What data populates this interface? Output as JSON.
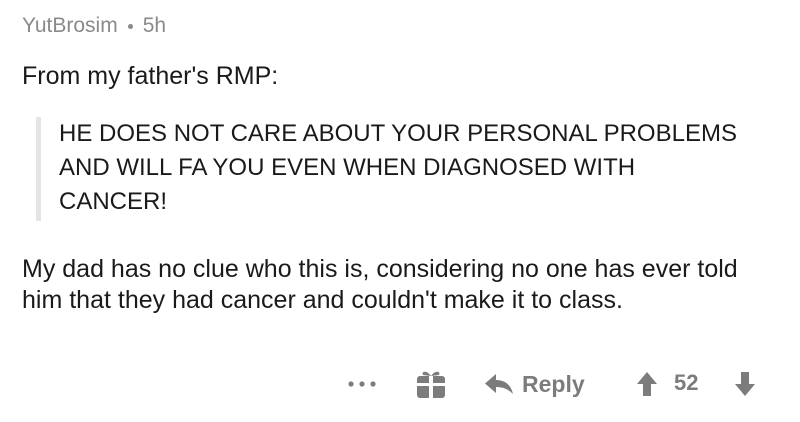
{
  "comment": {
    "author": "YutBrosim",
    "age": "5h",
    "lead": "From my father's RMP:",
    "quote": "HE DOES NOT CARE ABOUT YOUR PERSONAL PROBLEMS AND WILL FA YOU EVEN WHEN DIAGNOSED WITH CANCER!",
    "body": "My dad has no clue who this is, considering no one has ever told him that they had cancer and couldn't make it to class."
  },
  "actions": {
    "more_icon": "more-dots-icon",
    "gift_icon": "gift-icon",
    "reply_label": "Reply",
    "score": "52"
  },
  "colors": {
    "meta_text": "#8a8a8a",
    "body_text": "#1a1a1b",
    "action_gray": "#7c7c7c",
    "quote_bar": "#e4e4e4"
  }
}
